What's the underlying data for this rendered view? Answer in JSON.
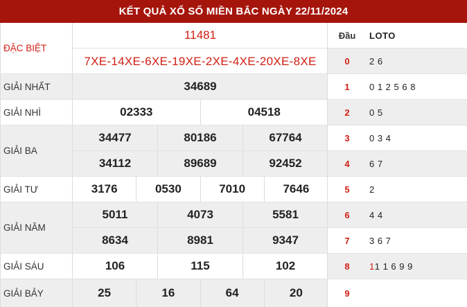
{
  "title": "KẾT QUẢ XỔ SỐ MIỀN BẮC NGÀY 22/11/2024",
  "prizes": {
    "db": {
      "label": "ĐẶC BIỆT",
      "number": "11481",
      "codes": "7XE-14XE-6XE-19XE-2XE-4XE-20XE-8XE"
    },
    "g1": {
      "label": "GIẢI NHẤT",
      "numbers": [
        "34689"
      ]
    },
    "g2": {
      "label": "GIẢI NHÌ",
      "numbers": [
        "02333",
        "04518"
      ]
    },
    "g3": {
      "label": "GIẢI BA",
      "numbers": [
        "34477",
        "80186",
        "67764",
        "34112",
        "89689",
        "92452"
      ]
    },
    "g4": {
      "label": "GIẢI TƯ",
      "numbers": [
        "3176",
        "0530",
        "7010",
        "7646"
      ]
    },
    "g5": {
      "label": "GIẢI NĂM",
      "numbers": [
        "5011",
        "4073",
        "5581",
        "8634",
        "8981",
        "9347"
      ]
    },
    "g6": {
      "label": "GIẢI SÁU",
      "numbers": [
        "106",
        "115",
        "102"
      ]
    },
    "g7": {
      "label": "GIẢI BẢY",
      "numbers": [
        "25",
        "16",
        "64",
        "20"
      ]
    }
  },
  "loto": {
    "head_dau": "Đầu",
    "head_loto": "LOTO",
    "rows": [
      {
        "dau": "0",
        "prefix": "",
        "rest": "2 6"
      },
      {
        "dau": "1",
        "prefix": "",
        "rest": "0 1 2 5 6 8"
      },
      {
        "dau": "2",
        "prefix": "",
        "rest": "0 5"
      },
      {
        "dau": "3",
        "prefix": "",
        "rest": "0 3 4"
      },
      {
        "dau": "4",
        "prefix": "",
        "rest": "6 7"
      },
      {
        "dau": "5",
        "prefix": "",
        "rest": "2"
      },
      {
        "dau": "6",
        "prefix": "",
        "rest": "4 4"
      },
      {
        "dau": "7",
        "prefix": "",
        "rest": "3 6 7"
      },
      {
        "dau": "8",
        "prefix": "1",
        "rest": " 1 1 6 9 9"
      },
      {
        "dau": "9",
        "prefix": "",
        "rest": ""
      }
    ]
  },
  "colors": {
    "header_bg": "#a5150c",
    "accent_red": "#d01e12",
    "row_gray": "#eeeeee"
  }
}
